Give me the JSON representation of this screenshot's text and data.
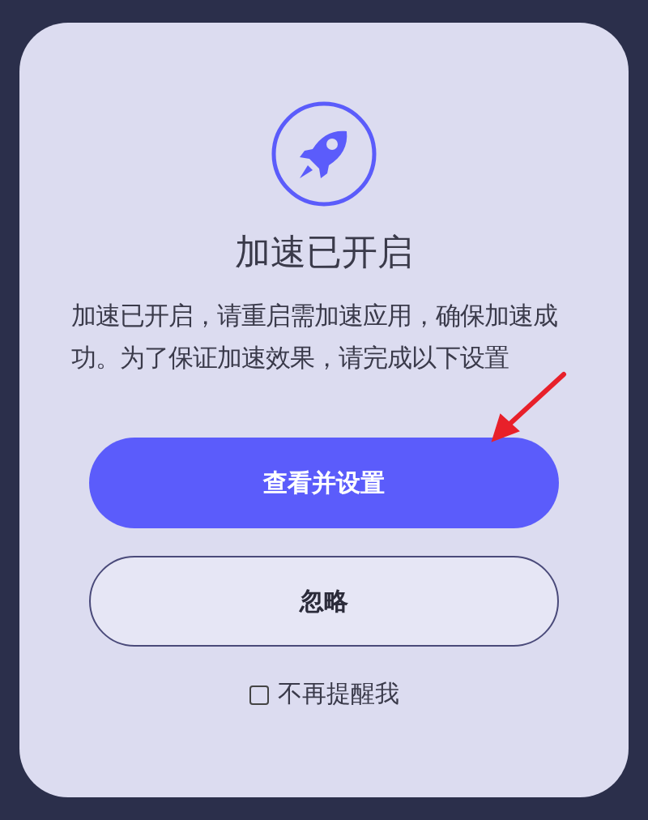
{
  "dialog": {
    "title": "加速已开启",
    "message": "加速已开启，请重启需加速应用，确保加速成功。为了保证加速效果，请完成以下设置",
    "buttons": [
      {
        "label": "查看并设置",
        "kind": "primary"
      },
      {
        "label": "忽略",
        "kind": "secondary"
      }
    ],
    "dont_remind": {
      "label": "不再提醒我",
      "checked": false
    }
  }
}
